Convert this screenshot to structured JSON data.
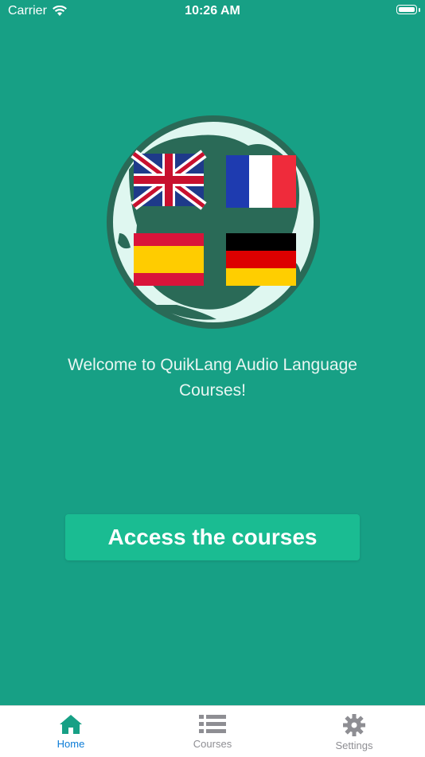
{
  "status_bar": {
    "carrier": "Carrier",
    "time": "10:26 AM"
  },
  "main": {
    "welcome_text": "Welcome to QuikLang Audio Language Courses!",
    "cta_label": "Access the courses",
    "logo_flags": [
      "uk-flag",
      "france-flag",
      "spain-flag",
      "germany-flag"
    ]
  },
  "tabs": [
    {
      "label": "Home",
      "icon": "home-icon",
      "active": true
    },
    {
      "label": "Courses",
      "icon": "list-icon",
      "active": false
    },
    {
      "label": "Settings",
      "icon": "gear-icon",
      "active": false
    }
  ],
  "colors": {
    "background": "#17a085",
    "button": "#1abc92",
    "active_tab": "#0a7bd6",
    "inactive_tab": "#8e8e93"
  }
}
